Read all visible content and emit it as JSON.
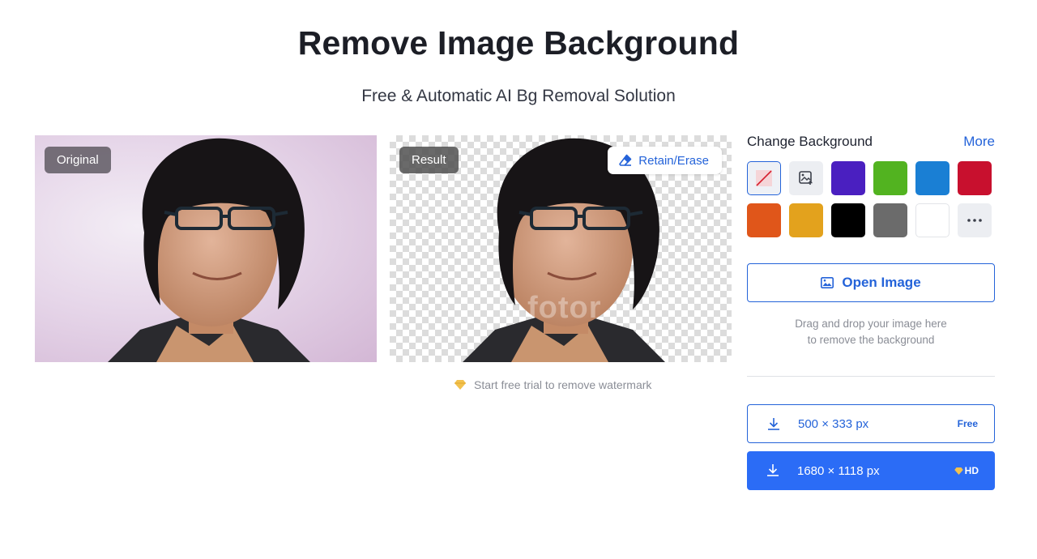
{
  "header": {
    "title": "Remove Image Background",
    "subtitle": "Free & Automatic AI Bg Removal Solution"
  },
  "preview": {
    "original_label": "Original",
    "result_label": "Result",
    "retain_erase_label": "Retain/Erase",
    "watermark_text": "fotor",
    "trial_note": "Start free trial to remove watermark"
  },
  "sidebar": {
    "change_background_label": "Change Background",
    "more_label": "More",
    "swatches": [
      {
        "name": "none",
        "color": "#eef1f6"
      },
      {
        "name": "image",
        "color": "#eceef2"
      },
      {
        "name": "purple",
        "color": "#4a1fc0"
      },
      {
        "name": "green",
        "color": "#52b320"
      },
      {
        "name": "blue",
        "color": "#1a7fd4"
      },
      {
        "name": "red",
        "color": "#c8102e"
      },
      {
        "name": "orange",
        "color": "#e0561a"
      },
      {
        "name": "amber",
        "color": "#e3a21d"
      },
      {
        "name": "black",
        "color": "#000000"
      },
      {
        "name": "gray",
        "color": "#6b6b6b"
      },
      {
        "name": "white",
        "color": "#ffffff"
      },
      {
        "name": "more-colors",
        "color": "#eceef2"
      }
    ],
    "open_image_label": "Open Image",
    "drop_hint_line1": "Drag and drop your image here",
    "drop_hint_line2": "to remove the background",
    "downloads": [
      {
        "size": "500 × 333 px",
        "badge": "Free"
      },
      {
        "size": "1680 × 1118 px",
        "badge": "HD"
      }
    ]
  },
  "colors": {
    "accent": "#2463d9",
    "primary_button": "#2b6cf6",
    "premium_gem": "#f2c14e"
  }
}
